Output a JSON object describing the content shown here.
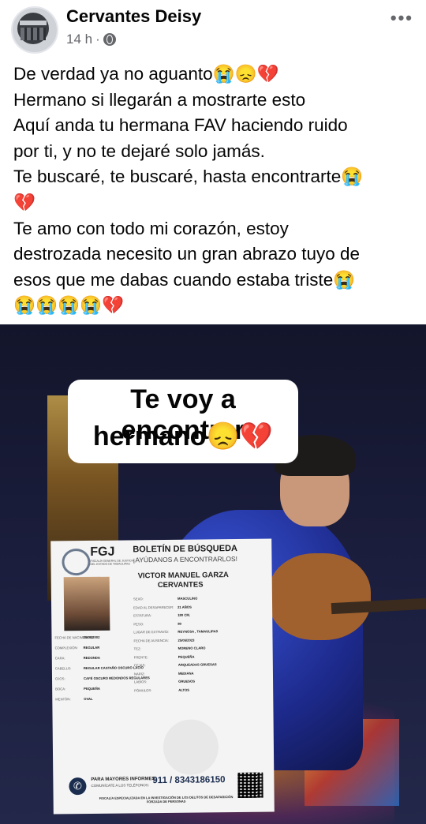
{
  "post": {
    "author": "Cervantes Deisy",
    "time": "14 h",
    "text": "De verdad ya no aguanto😭😞💔\nHermano si llegarán a mostrarte esto\nAquí anda tu hermana FAV haciendo ruido\npor ti, y no te dejaré solo jamás.\nTe buscaré, te buscaré, hasta encontrarte😭\n💔\nTe amo con todo mi corazón, estoy\ndestrozada necesito un gran abrazo tuyo de\nesos que me dabas cuando estaba triste😭\n😭😭😭😭💔",
    "more_label": "•••"
  },
  "image": {
    "caption_line1": "Te voy a encontrar",
    "caption_line2": "hermano😞💔",
    "bulletin": {
      "agency": "FGJ",
      "agency_sub": "FISCALÍA GENERAL DE JUSTICIA DEL ESTADO DE TAMAULIPAS",
      "title": "BOLETÍN DE BÚSQUEDA",
      "subtitle": "¡AYÚDANOS A ENCONTRARLOS!",
      "name_line1": "VICTOR MANUEL GARZA",
      "name_line2": "CERVANTES",
      "fields": [
        {
          "label": "SEXO:",
          "value": "MASCULINO"
        },
        {
          "label": "EDAD AL DESAPARECER:",
          "value": "21 AÑOS"
        },
        {
          "label": "ESTATURA:",
          "value": "180 CM."
        },
        {
          "label": "PESO:",
          "value": "80"
        },
        {
          "label": "LUGAR DE EXTRAVÍO:",
          "value": "REYNOSA , TAMAULIPAS"
        },
        {
          "label": "FECHA DE AUSENCIA:",
          "value": "25/05/2023"
        },
        {
          "label": "TEZ:",
          "value": "MORENO CLARO"
        },
        {
          "label": "FRENTE:",
          "value": "PEQUEÑA"
        },
        {
          "label": "CEJAS:",
          "value": "ARQUEADAS GRUESAS"
        },
        {
          "label": "NARIZ:",
          "value": "MEDIANA"
        },
        {
          "label": "LABIOS:",
          "value": "GRUESOS"
        },
        {
          "label": "PÓMULOS:",
          "value": "ALTOS"
        }
      ],
      "left_fields": [
        {
          "label": "FECHA DE NACIMIENTO:",
          "value": "25/05/2002"
        },
        {
          "label": "COMPLEXIÓN:",
          "value": "REGULAR"
        },
        {
          "label": "CARA:",
          "value": "REDONDA"
        },
        {
          "label": "CABELLO:",
          "value": "REGULAR CASTAÑO OSCURO LACIO"
        },
        {
          "label": "OJOS:",
          "value": "CAFÉ OSCURO REDONDOS REGULARES"
        },
        {
          "label": "BOCA:",
          "value": "PEQUEÑA"
        },
        {
          "label": "MENTÓN:",
          "value": "OVAL"
        }
      ],
      "contact_label": "PARA MAYORES INFORMES,",
      "contact_sub": "COMUNÍCATE A LOS TELÉFONOS:",
      "phone": "911 / 8343186150",
      "fiscalia": "FISCALÍA ESPECIALIZADA EN LA INVESTIGACIÓN DE LOS DELITOS DE DESAPARICIÓN FORZADA DE PERSONAS"
    }
  }
}
